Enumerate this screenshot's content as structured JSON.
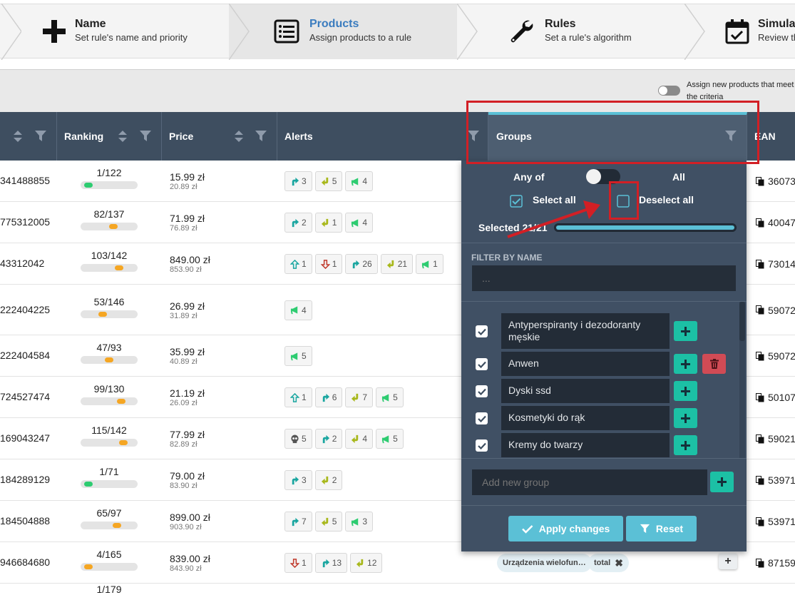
{
  "wizard": {
    "steps": [
      {
        "title": "Name",
        "subtitle": "Set rule's name and priority",
        "icon": "plus-icon"
      },
      {
        "title": "Products",
        "subtitle": "Assign products to a rule",
        "icon": "list-icon",
        "active": true
      },
      {
        "title": "Rules",
        "subtitle": "Set a rule's algorithm",
        "icon": "wrench-icon"
      },
      {
        "title": "Simula",
        "subtitle": "Review th",
        "icon": "calendar-check-icon"
      }
    ]
  },
  "toolbar": {
    "assign_toggle_on": false,
    "assign_text": "Assign new products that meet the criteria"
  },
  "columns": {
    "ranking": "Ranking",
    "price": "Price",
    "alerts": "Alerts",
    "groups": "Groups",
    "ean": "EAN"
  },
  "rows": [
    {
      "id": "341488855",
      "ranking": "1/122",
      "rank_level": 0.05,
      "rank_color": "#2ecc71",
      "price": "15.99 zł",
      "old_price": "20.89 zł",
      "ean": "36073",
      "alerts": [
        {
          "icon": "trend-up-icon",
          "color": "#1aa6a0",
          "count": "3"
        },
        {
          "icon": "trend-down-icon",
          "color": "#a8b81c",
          "count": "5"
        },
        {
          "icon": "megaphone-icon",
          "color": "#2ecc71",
          "count": "4"
        }
      ]
    },
    {
      "id": "775312005",
      "ranking": "82/137",
      "rank_level": 0.6,
      "rank_color": "#f5a623",
      "price": "71.99 zł",
      "old_price": "76.89 zł",
      "ean": "40047",
      "alerts": [
        {
          "icon": "trend-up-icon",
          "color": "#1aa6a0",
          "count": "2"
        },
        {
          "icon": "trend-down-icon",
          "color": "#a8b81c",
          "count": "1"
        },
        {
          "icon": "megaphone-icon",
          "color": "#2ecc71",
          "count": "4"
        }
      ]
    },
    {
      "id": "43312042",
      "ranking": "103/142",
      "rank_level": 0.72,
      "rank_color": "#f5a623",
      "price": "849.00 zł",
      "old_price": "853.90 zł",
      "ean": "73014",
      "alerts": [
        {
          "icon": "arrow-up-icon",
          "color": "#1aa6a0",
          "count": "1"
        },
        {
          "icon": "arrow-down-icon",
          "color": "#c0392b",
          "count": "1"
        },
        {
          "icon": "trend-up-icon",
          "color": "#1aa6a0",
          "count": "26"
        },
        {
          "icon": "trend-down-icon",
          "color": "#a8b81c",
          "count": "21"
        },
        {
          "icon": "megaphone-icon",
          "color": "#2ecc71",
          "count": "1"
        }
      ]
    },
    {
      "id": "222404225",
      "ranking": "53/146",
      "rank_level": 0.36,
      "rank_color": "#f5a623",
      "price": "26.99 zł",
      "old_price": "31.89 zł",
      "ean": "59072",
      "alerts": [
        {
          "icon": "megaphone-icon",
          "color": "#2ecc71",
          "count": "4"
        }
      ]
    },
    {
      "id": "222404584",
      "ranking": "47/93",
      "rank_level": 0.5,
      "rank_color": "#f5a623",
      "price": "35.99 zł",
      "old_price": "40.89 zł",
      "ean": "59072",
      "alerts": [
        {
          "icon": "megaphone-icon",
          "color": "#2ecc71",
          "count": "5"
        }
      ]
    },
    {
      "id": "724527474",
      "ranking": "99/130",
      "rank_level": 0.76,
      "rank_color": "#f5a623",
      "price": "21.19 zł",
      "old_price": "26.09 zł",
      "ean": "50107",
      "alerts": [
        {
          "icon": "arrow-up-icon",
          "color": "#1aa6a0",
          "count": "1"
        },
        {
          "icon": "trend-up-icon",
          "color": "#1aa6a0",
          "count": "6"
        },
        {
          "icon": "trend-down-icon",
          "color": "#a8b81c",
          "count": "7"
        },
        {
          "icon": "megaphone-icon",
          "color": "#2ecc71",
          "count": "5"
        }
      ]
    },
    {
      "id": "169043247",
      "ranking": "115/142",
      "rank_level": 0.81,
      "rank_color": "#f5a623",
      "price": "77.99 zł",
      "old_price": "82.89 zł",
      "ean": "59021",
      "alerts": [
        {
          "icon": "skull-icon",
          "color": "#555555",
          "count": "5"
        },
        {
          "icon": "trend-up-icon",
          "color": "#1aa6a0",
          "count": "2"
        },
        {
          "icon": "trend-down-icon",
          "color": "#a8b81c",
          "count": "4"
        },
        {
          "icon": "megaphone-icon",
          "color": "#2ecc71",
          "count": "5"
        }
      ]
    },
    {
      "id": "184289129",
      "ranking": "1/71",
      "rank_level": 0.05,
      "rank_color": "#2ecc71",
      "price": "79.00 zł",
      "old_price": "83.90 zł",
      "ean": "53971",
      "alerts": [
        {
          "icon": "trend-up-icon",
          "color": "#1aa6a0",
          "count": "3"
        },
        {
          "icon": "trend-down-icon",
          "color": "#a8b81c",
          "count": "2"
        }
      ]
    },
    {
      "id": "184504888",
      "ranking": "65/97",
      "rank_level": 0.67,
      "rank_color": "#f5a623",
      "price": "899.00 zł",
      "old_price": "903.90 zł",
      "ean": "53971",
      "alerts": [
        {
          "icon": "trend-up-icon",
          "color": "#1aa6a0",
          "count": "7"
        },
        {
          "icon": "trend-down-icon",
          "color": "#a8b81c",
          "count": "5"
        },
        {
          "icon": "megaphone-icon",
          "color": "#2ecc71",
          "count": "3"
        }
      ]
    },
    {
      "id": "946684680",
      "ranking": "4/165",
      "rank_level": 0.05,
      "rank_color": "#f5a623",
      "price": "839.00 zł",
      "old_price": "843.90 zł",
      "ean": "87159",
      "alerts": [
        {
          "icon": "arrow-down-icon",
          "color": "#c0392b",
          "count": "1"
        },
        {
          "icon": "trend-up-icon",
          "color": "#1aa6a0",
          "count": "13"
        },
        {
          "icon": "trend-down-icon",
          "color": "#a8b81c",
          "count": "12"
        }
      ],
      "groups": [
        {
          "label": "Urządzenia wielofun…"
        },
        {
          "label": "total",
          "removable": true
        }
      ]
    },
    {
      "id": "",
      "ranking": "1/179",
      "rank_level": 0.05,
      "rank_color": "#2ecc71",
      "price": "",
      "old_price": "",
      "ean": "",
      "alerts": []
    }
  ],
  "groups_filter": {
    "any_of_label": "Any of",
    "all_label": "All",
    "mode_all": false,
    "select_all_label": "Select all",
    "select_all_checked": true,
    "deselect_all_label": "Deselect all",
    "deselect_all_checked": false,
    "selected_label": "Selected 21/21",
    "selected_fraction": 1.0,
    "filter_by_name_label": "FILTER BY NAME",
    "filter_placeholder": "...",
    "groups": [
      {
        "name": "Antyperspiranty i dezodoranty męskie",
        "checked": true,
        "deletable": false
      },
      {
        "name": "Anwen",
        "checked": true,
        "deletable": true
      },
      {
        "name": "Dyski ssd",
        "checked": true,
        "deletable": false
      },
      {
        "name": "Kosmetyki do rąk",
        "checked": true,
        "deletable": false
      },
      {
        "name": "Kremy do twarzy",
        "checked": true,
        "deletable": false
      }
    ],
    "new_group_placeholder": "Add new group",
    "apply_label": "Apply changes",
    "reset_label": "Reset"
  },
  "colors": {
    "header_bg": "#3e4e60",
    "panel_bg": "#405064",
    "accent": "#5bc0d6",
    "add_button": "#1cc0a5",
    "delete_button": "#d14b55",
    "annotation": "#d21f25"
  }
}
